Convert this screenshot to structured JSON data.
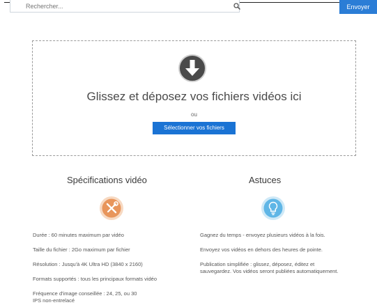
{
  "header": {
    "search_placeholder": "Rechercher...",
    "upload_button_label": "Envoyer"
  },
  "dropzone": {
    "title": "Glissez et déposez vos fichiers vidéos ici",
    "or_text": "ou",
    "select_button_label": "Sélectionner vos fichiers"
  },
  "specs": {
    "title": "Spécifications vidéo",
    "items": [
      "Durée : 60 minutes maximum par vidéo",
      "Taille du fichier : 2Go maximum par fichier",
      "Résolution : Jusqu'à 4K Ultra HD (3840 x 2160)",
      "Formats supportés : tous les principaux formats vidéo",
      "Fréquence d'image conseillée : 24, 25, ou 30 IPS non-entrelacé"
    ]
  },
  "tips": {
    "title": "Astuces",
    "items": [
      "Gagnez du temps - envoyez plusieurs vidéos à la fois.",
      "Envoyez vos vidéos en dehors des heures de pointe.",
      "Publication simplifiée : glissez, déposez, éditez et sauvegardez. Vos vidéos seront publiées automatiquement."
    ]
  },
  "colors": {
    "primary_blue": "#1a73d4",
    "tools_orange": "#e8955b",
    "bulb_blue": "#5fb6e6",
    "download_dark": "#4a4a4a"
  },
  "icons": {
    "search": "search-icon",
    "download": "download-icon",
    "tools": "tools-icon",
    "bulb": "lightbulb-icon"
  }
}
